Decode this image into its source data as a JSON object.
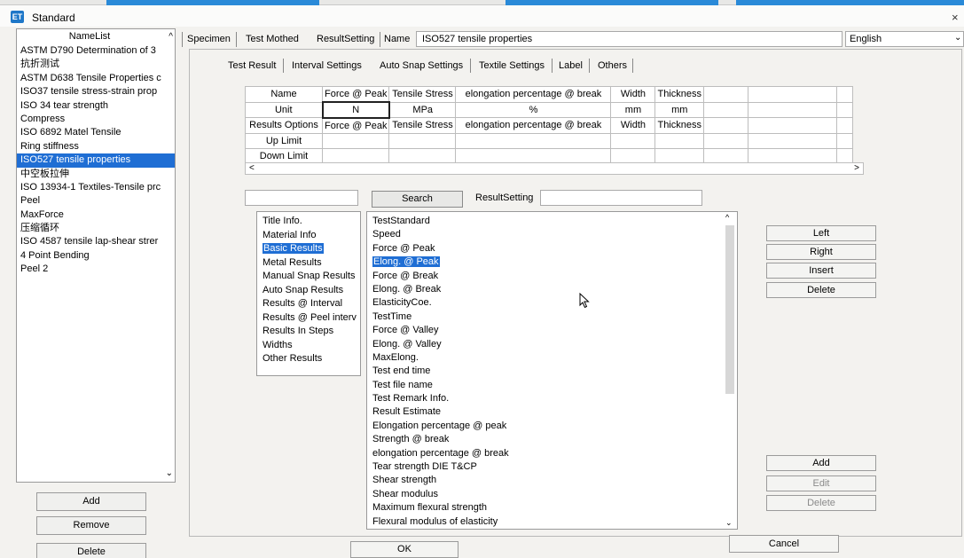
{
  "window": {
    "title": "Standard",
    "close_glyph": "×",
    "icon_text": "ET"
  },
  "namelist": {
    "header": "NameList",
    "items": [
      "ASTM D790 Determination of 3",
      "抗折测试",
      "ASTM D638 Tensile Properties c",
      "ISO37 tensile stress-strain prop",
      "ISO 34 tear strength",
      "Compress",
      "ISO 6892  Matel Tensile",
      "Ring stiffness",
      "ISO527 tensile properties",
      "中空板拉伸",
      "ISO 13934-1 Textiles-Tensile prc",
      "Peel",
      "MaxForce",
      "压缩循环",
      "ISO 4587 tensile lap-shear strer",
      "4 Point Bending",
      "Peel 2"
    ],
    "selected_index": 8,
    "buttons": {
      "add": "Add",
      "remove": "Remove",
      "delete": "Delete"
    }
  },
  "top_tabs": {
    "specimen": "Specimen",
    "test_method": "Test Mothed",
    "result_setting": "ResultSetting",
    "name_label": "Name"
  },
  "name_value": "ISO527 tensile properties",
  "language": {
    "value": "English"
  },
  "sub_tabs": [
    "Test Result",
    "Interval Settings",
    "Auto Snap Settings",
    "Textile Settings",
    "Label",
    "Others"
  ],
  "grid": {
    "row_headers": [
      "Name",
      "Unit",
      "Results Options",
      "Up Limit",
      "Down Limit"
    ],
    "columns": [
      {
        "name": "Force @ Peak",
        "unit": "N",
        "option": "Force @ Peak"
      },
      {
        "name": "Tensile Stress",
        "unit": "MPa",
        "option": "Tensile Stress"
      },
      {
        "name": "elongation percentage @ break",
        "unit": "%",
        "option": "elongation percentage @ break"
      },
      {
        "name": "Width",
        "unit": "mm",
        "option": "Width"
      },
      {
        "name": "Thickness",
        "unit": "mm",
        "option": "Thickness"
      }
    ],
    "scroll_left": "<",
    "scroll_right": ">"
  },
  "search": {
    "button": "Search",
    "result_setting_label": "ResultSetting"
  },
  "categories": {
    "items": [
      "Title Info.",
      "Material Info",
      "Basic Results",
      "Metal Results",
      "Manual Snap Results",
      "Auto Snap Results",
      "Results @ Interval",
      "Results @ Peel interv",
      "Results In Steps",
      "Widths",
      "Other Results"
    ],
    "selected_index": 2
  },
  "results": {
    "items": [
      "TestStandard",
      "Speed",
      "Force @ Peak",
      "Elong. @ Peak",
      "Force @ Break",
      "Elong. @ Break",
      "ElasticityCoe.",
      "TestTime",
      "Force @ Valley",
      "Elong. @ Valley",
      "MaxElong.",
      "Test end time",
      "Test file name",
      "Test Remark Info.",
      "Result Estimate",
      "Elongation percentage @ peak",
      "Strength @ break",
      "elongation percentage @ break",
      "Tear strength DIE T&CP",
      "Shear strength",
      "Shear modulus",
      "Maximum flexural strength",
      "Flexural modulus of elasticity"
    ],
    "selected_index": 3
  },
  "side_buttons": {
    "left": "Left",
    "right": "Right",
    "insert": "Insert",
    "delete": "Delete",
    "add": "Add",
    "edit": "Edit",
    "delete2": "Delete"
  },
  "footer": {
    "ok": "OK",
    "cancel": "Cancel"
  },
  "icons": {
    "scroll_up": "^",
    "scroll_down": "⌄",
    "dropdown": "⌄"
  }
}
